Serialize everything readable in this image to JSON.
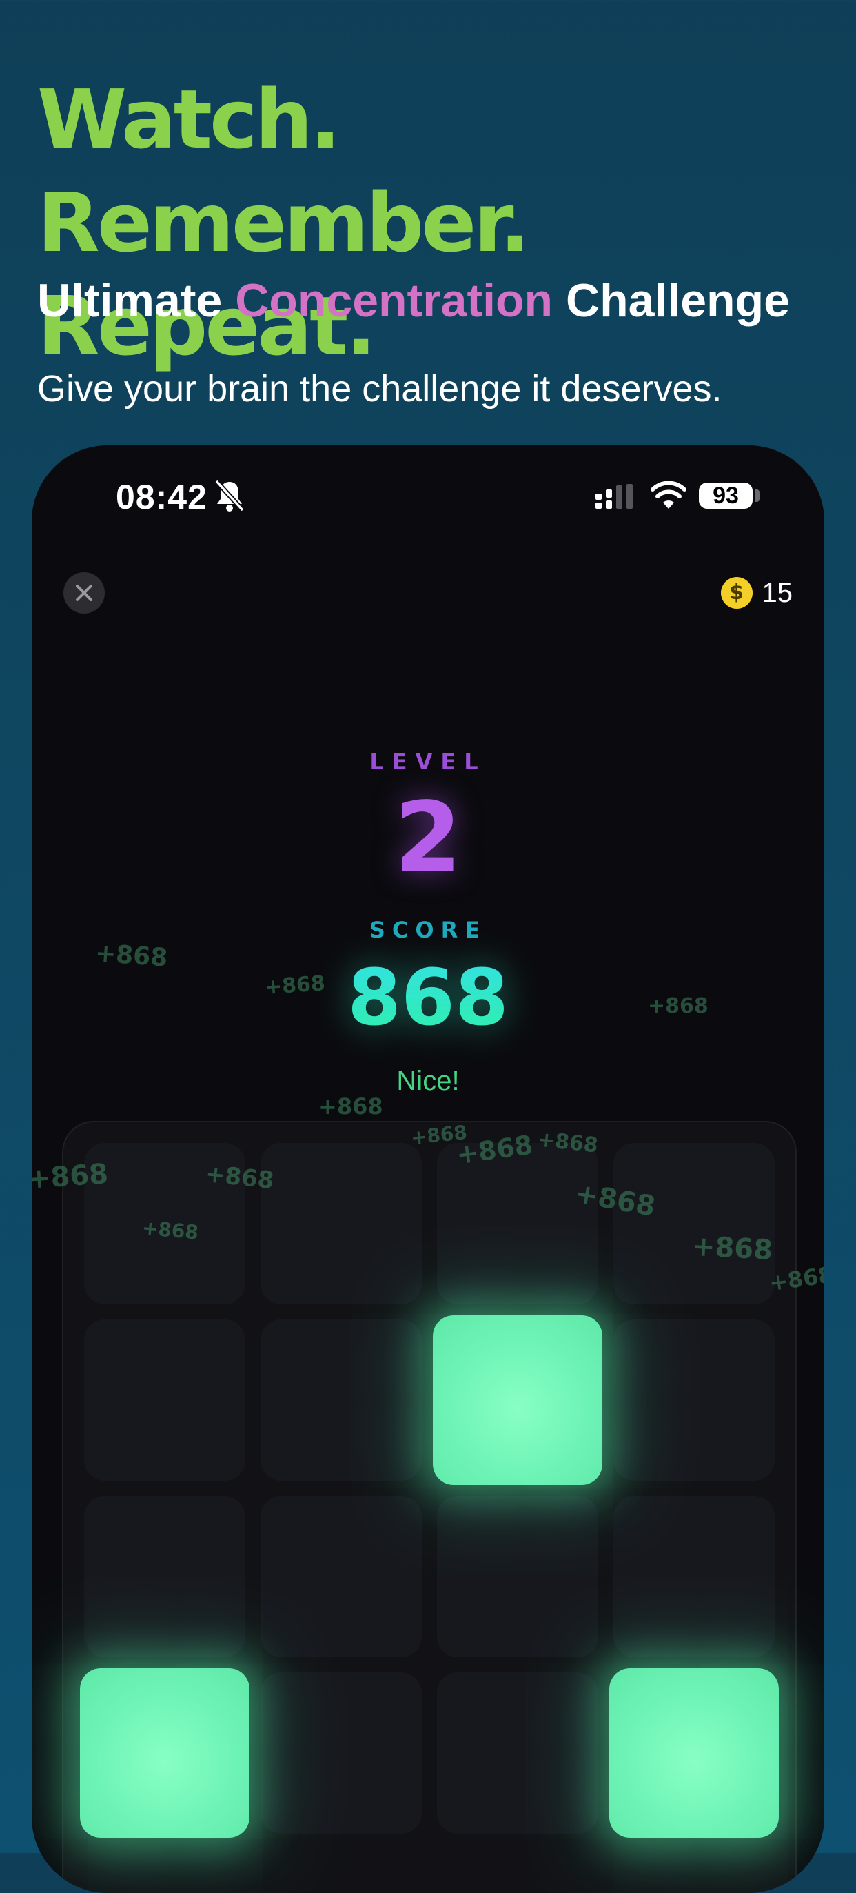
{
  "headline": "Watch. Remember. Repeat.",
  "subtitle": {
    "before": "Ultimate ",
    "accent": "Concentration",
    "after": " Challenge"
  },
  "tagline": "Give your brain the challenge it deserves.",
  "status_bar": {
    "time": "08:42",
    "battery": "93"
  },
  "coins": {
    "icon_symbol": "$",
    "count": "15"
  },
  "game": {
    "level_label": "LEVEL",
    "level": "2",
    "score_label": "SCORE",
    "score": "868",
    "feedback": "Nice!"
  },
  "floating_points": "+868",
  "grid": {
    "rows": 4,
    "columns": 4,
    "lit_tiles": [
      "r2c3",
      "r4c1",
      "r4c4"
    ]
  },
  "colors": {
    "headline": "#8bd14c",
    "accent": "#d473c6",
    "level": "#b55eea",
    "score": "#2ef0a8",
    "lit_tile": "#6ef3b6"
  }
}
